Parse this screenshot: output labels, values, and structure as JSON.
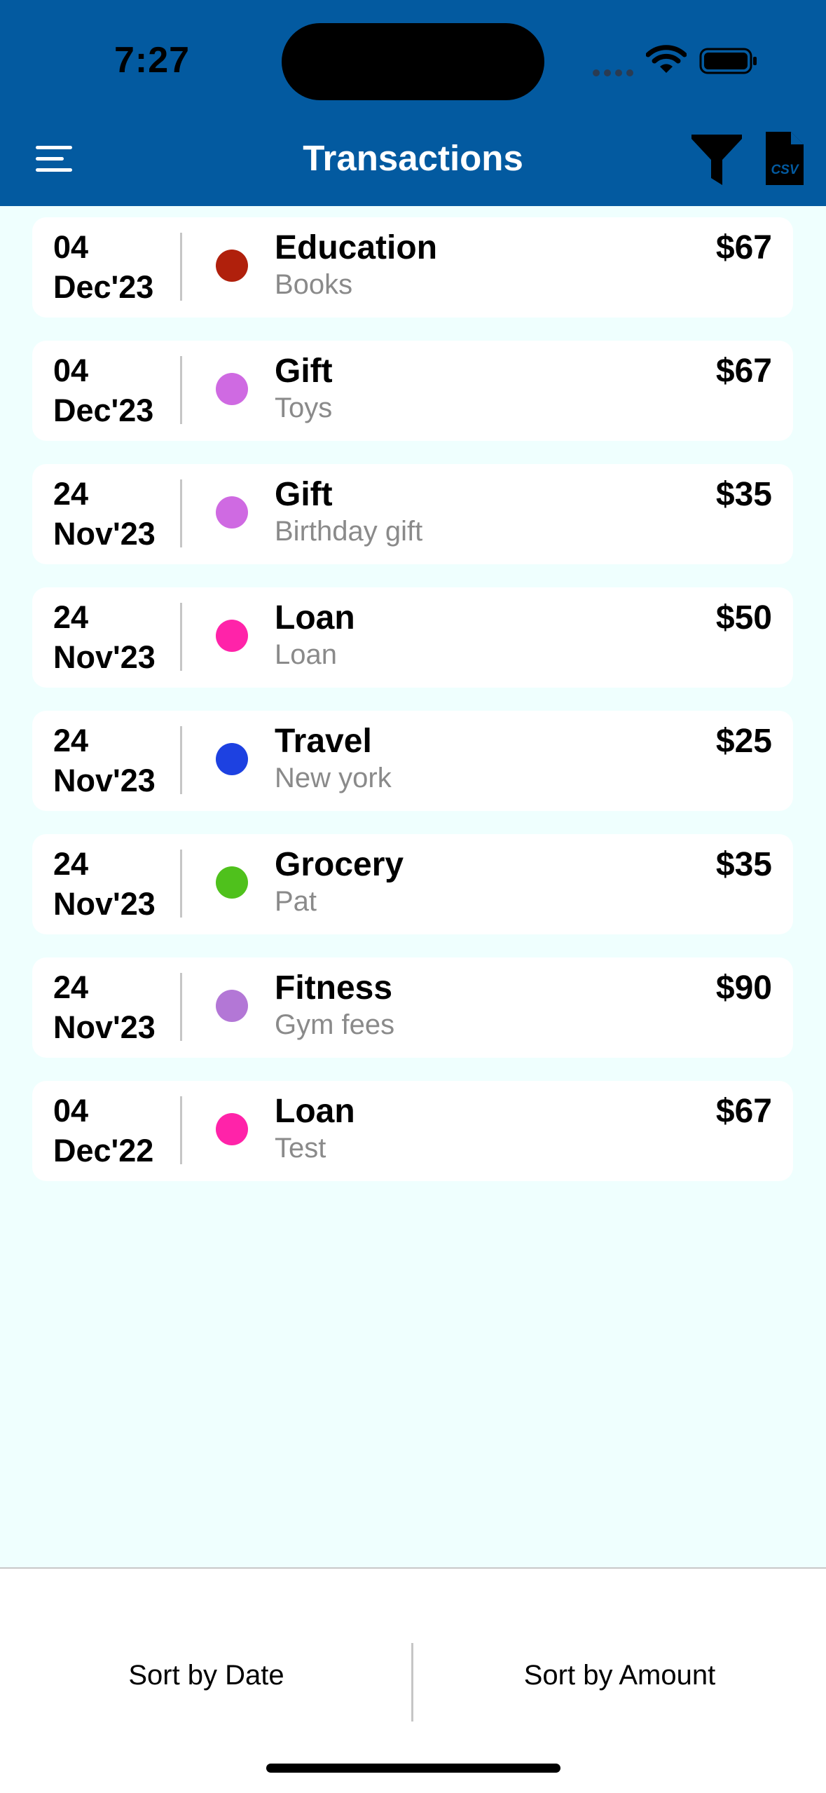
{
  "status_bar": {
    "time": "7:27"
  },
  "header": {
    "title": "Transactions"
  },
  "transactions": [
    {
      "day": "04",
      "month": "Dec'23",
      "category": "Education",
      "note": "Books",
      "amount": "$67",
      "color": "#b0200c"
    },
    {
      "day": "04",
      "month": "Dec'23",
      "category": "Gift",
      "note": "Toys",
      "amount": "$67",
      "color": "#cf6ae2"
    },
    {
      "day": "24",
      "month": "Nov'23",
      "category": "Gift",
      "note": "Birthday gift",
      "amount": "$35",
      "color": "#cf6ae2"
    },
    {
      "day": "24",
      "month": "Nov'23",
      "category": "Loan",
      "note": "Loan",
      "amount": "$50",
      "color": "#ff23a9"
    },
    {
      "day": "24",
      "month": "Nov'23",
      "category": "Travel",
      "note": "New york",
      "amount": "$25",
      "color": "#1d41e1"
    },
    {
      "day": "24",
      "month": "Nov'23",
      "category": "Grocery",
      "note": "Pat",
      "amount": "$35",
      "color": "#4fc11c"
    },
    {
      "day": "24",
      "month": "Nov'23",
      "category": "Fitness",
      "note": "Gym fees",
      "amount": "$90",
      "color": "#b377d6"
    },
    {
      "day": "04",
      "month": "Dec'22",
      "category": "Loan",
      "note": "Test",
      "amount": "$67",
      "color": "#ff23a9"
    }
  ],
  "bottom_bar": {
    "sort_by_date": "Sort by Date",
    "sort_by_amount": "Sort by Amount"
  },
  "icons": {
    "menu": "hamburger-menu",
    "filter": "funnel",
    "export": "csv-file"
  },
  "colors": {
    "header": "#035aa0",
    "background": "#effffe"
  }
}
